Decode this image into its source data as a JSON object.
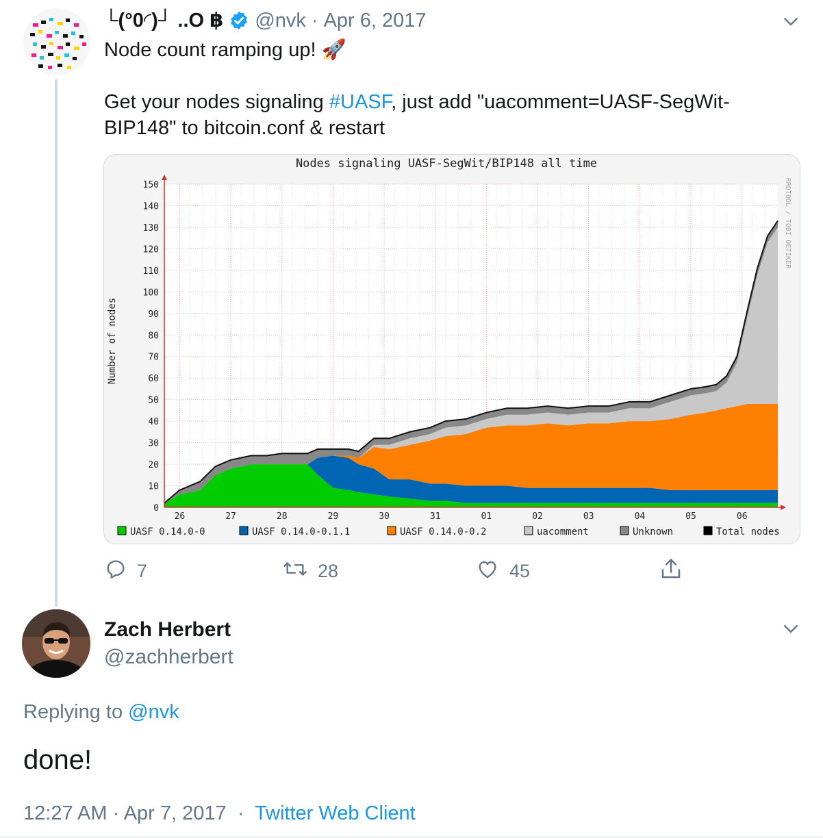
{
  "tweet": {
    "display_name": "└(°0◜)┘ ..O ฿",
    "handle": "@nvk",
    "separator": "·",
    "date": "Apr 6, 2017",
    "line1": "Node count ramping up! 🚀",
    "line2_pre": "Get your nodes signaling ",
    "hashtag": "#UASF",
    "line2_post": ", just add \"uacomment=UASF-SegWit-BIP148\" to bitcoin.conf & restart",
    "actions": {
      "replies": "7",
      "retweets": "28",
      "likes": "45"
    }
  },
  "reply": {
    "display_name": "Zach Herbert",
    "handle": "@zachherbert",
    "replying_prefix": "Replying to ",
    "replying_handle": "@nvk",
    "text": "done!",
    "time": "12:27 AM · Apr 7, 2017",
    "separator": "·",
    "client": "Twitter Web Client"
  },
  "icons": [
    "verified-badge-icon",
    "chevron-down-icon",
    "reply-icon",
    "retweet-icon",
    "like-icon",
    "share-icon"
  ],
  "colors": {
    "link": "#1b95e0",
    "muted": "#657786",
    "green": "#00cc00",
    "blue": "#0066b3",
    "orange": "#ff8000",
    "light_gray": "#c8c8c8",
    "dark_gray": "#888888"
  },
  "chart_data": {
    "type": "area",
    "title": "Nodes signaling UASF-SegWit/BIP148 all time",
    "ylabel": "Number of nodes",
    "watermark": "RRDTOOL / TOBI OETIKER",
    "yticks": [
      0,
      10,
      20,
      30,
      40,
      50,
      60,
      70,
      80,
      90,
      100,
      110,
      120,
      130,
      140,
      150
    ],
    "ylim": [
      0,
      150
    ],
    "categories": [
      "26",
      "27",
      "28",
      "29",
      "30",
      "31",
      "01",
      "02",
      "03",
      "04",
      "05",
      "06"
    ],
    "xlim": [
      25.7,
      37.7
    ],
    "x": [
      25.7,
      26.0,
      26.4,
      26.7,
      27.0,
      27.4,
      27.7,
      28.0,
      28.3,
      28.5,
      28.7,
      29.0,
      29.3,
      29.5,
      29.8,
      30.1,
      30.5,
      30.9,
      31.2,
      31.6,
      32.0,
      32.4,
      32.8,
      33.2,
      33.6,
      34.0,
      34.4,
      34.8,
      35.2,
      35.6,
      36.0,
      36.3,
      36.5,
      36.7,
      36.9,
      37.1,
      37.3,
      37.5,
      37.7
    ],
    "series": [
      {
        "name": "UASF 0.14.0-0",
        "values": [
          2,
          6,
          8,
          15,
          18,
          20,
          20,
          20,
          20,
          20,
          15,
          9,
          8,
          7,
          6,
          5,
          4,
          3,
          3,
          2,
          2,
          2,
          2,
          2,
          2,
          2,
          2,
          2,
          2,
          2,
          2,
          2,
          2,
          2,
          2,
          2,
          2,
          2,
          2
        ]
      },
      {
        "name": "UASF 0.14.0-0.1.1",
        "values": [
          0,
          0,
          0,
          0,
          0,
          0,
          0,
          0,
          0,
          0,
          8,
          15,
          15,
          13,
          12,
          8,
          9,
          8,
          8,
          8,
          8,
          8,
          7,
          7,
          7,
          7,
          7,
          7,
          7,
          6,
          6,
          6,
          6,
          6,
          6,
          6,
          6,
          6,
          6
        ]
      },
      {
        "name": "UASF 0.14.0-0.2",
        "values": [
          0,
          0,
          0,
          0,
          0,
          0,
          0,
          0,
          0,
          0,
          0,
          0,
          1,
          3,
          10,
          14,
          16,
          20,
          22,
          24,
          27,
          28,
          29,
          30,
          29,
          30,
          30,
          31,
          31,
          33,
          35,
          36,
          37,
          38,
          39,
          40,
          40,
          40,
          40
        ]
      },
      {
        "name": "uacomment",
        "values": [
          0,
          0,
          0,
          0,
          0,
          0,
          0,
          0,
          0,
          0,
          0,
          0,
          0,
          0,
          1,
          2,
          3,
          3,
          4,
          4,
          4,
          5,
          5,
          5,
          5,
          5,
          5,
          6,
          6,
          8,
          9,
          9,
          9,
          12,
          20,
          40,
          60,
          75,
          82
        ]
      },
      {
        "name": "Unknown",
        "values": [
          0,
          2,
          4,
          4,
          4,
          4,
          4,
          5,
          5,
          5,
          4,
          3,
          3,
          3,
          3,
          3,
          3,
          3,
          3,
          3,
          3,
          3,
          3,
          3,
          3,
          3,
          3,
          3,
          3,
          3,
          3,
          3,
          3,
          3,
          3,
          3,
          3,
          3,
          3
        ]
      },
      {
        "name": "Total nodes",
        "values": [
          2,
          8,
          12,
          19,
          22,
          24,
          24,
          25,
          25,
          25,
          27,
          27,
          27,
          26,
          32,
          32,
          35,
          37,
          40,
          41,
          44,
          46,
          46,
          47,
          46,
          47,
          47,
          49,
          49,
          52,
          55,
          56,
          57,
          61,
          70,
          91,
          111,
          126,
          133
        ]
      }
    ],
    "legend": [
      "UASF 0.14.0-0",
      "UASF 0.14.0-0.1.1",
      "UASF 0.14.0-0.2",
      "uacomment",
      "Unknown",
      "Total nodes"
    ],
    "legend_placement": "bottom",
    "grid": true
  }
}
